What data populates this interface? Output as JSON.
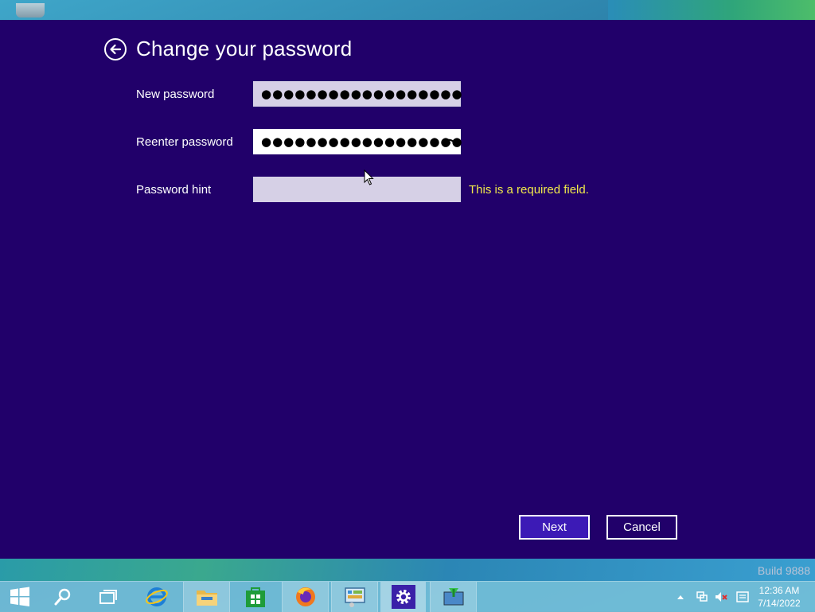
{
  "dialog": {
    "title": "Change your password",
    "new_password_label": "New password",
    "new_password_value": "●●●●●●●●●●●●●●●●●●",
    "reenter_password_label": "Reenter password",
    "reenter_password_value": "●●●●●●●●●●●●●●●●●●",
    "hint_label": "Password hint",
    "hint_value": "",
    "hint_error": "This is a required field.",
    "next_label": "Next",
    "cancel_label": "Cancel"
  },
  "desktop": {
    "build_text": "Build 9888"
  },
  "taskbar": {
    "apps": [
      "start-icon",
      "search-icon",
      "task-view-icon",
      "internet-explorer-icon",
      "file-explorer-icon",
      "store-icon",
      "firefox-icon",
      "control-panel-icon",
      "settings-icon",
      "remote-desktop-icon"
    ],
    "clock_time": "12:36 AM",
    "clock_date": "7/14/2022"
  },
  "colors": {
    "panel": "#21006a",
    "primary_button": "#3c1ab6",
    "error_text": "#f1e84a"
  }
}
